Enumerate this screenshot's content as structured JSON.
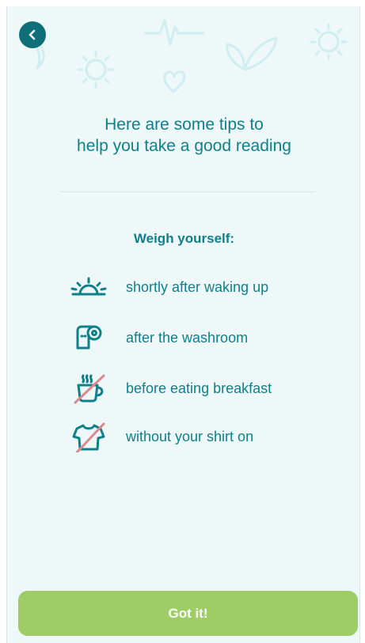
{
  "header": {
    "back_icon": "chevron-left-icon",
    "title_line1": "Here are some tips to",
    "title_line2": "help you take a good reading"
  },
  "tips": {
    "heading": "Weigh yourself:",
    "items": [
      {
        "icon": "sunrise-icon",
        "label": "shortly after waking up"
      },
      {
        "icon": "toilet-paper-icon",
        "label": "after the washroom"
      },
      {
        "icon": "coffee-cup-crossed-icon",
        "label": "before eating breakfast"
      },
      {
        "icon": "shirt-crossed-icon",
        "label": "without your shirt on"
      }
    ]
  },
  "footer": {
    "button_label": "Got it!"
  },
  "colors": {
    "background": "#eef8f9",
    "primary_text": "#0f7f8a",
    "back_button": "#0e6f78",
    "button": "#9ecd66",
    "cross_out": "#d98a8f",
    "decoration": "#cfeef2"
  }
}
